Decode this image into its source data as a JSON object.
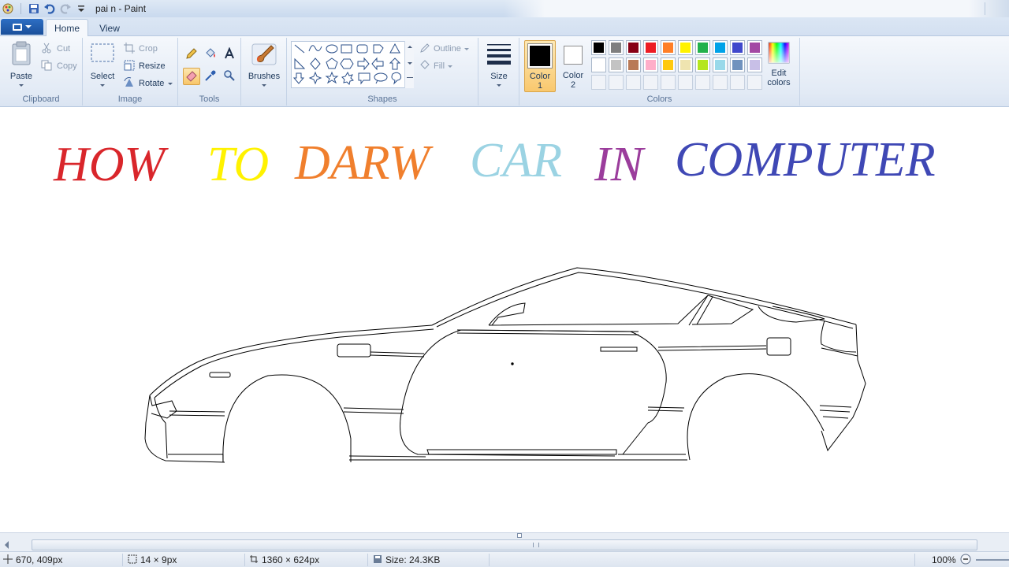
{
  "window": {
    "title": "pai n - Paint"
  },
  "tabs": {
    "home": "Home",
    "view": "View"
  },
  "ribbon": {
    "clipboard": {
      "label": "Clipboard",
      "paste": "Paste",
      "cut": "Cut",
      "copy": "Copy"
    },
    "image": {
      "label": "Image",
      "select": "Select",
      "crop": "Crop",
      "resize": "Resize",
      "rotate": "Rotate"
    },
    "tools": {
      "label": "Tools"
    },
    "brushes": {
      "label": "Brushes"
    },
    "shapes": {
      "label": "Shapes",
      "outline": "Outline",
      "fill": "Fill"
    },
    "size": {
      "label": "Size"
    },
    "colors": {
      "label": "Colors",
      "color1": "Color",
      "color1_num": "1",
      "color2": "Color",
      "color2_num": "2",
      "edit": "Edit",
      "edit2": "colors",
      "color1_value": "#000000",
      "color2_value": "#ffffff",
      "palette_row1": [
        "#000000",
        "#7f7f7f",
        "#880015",
        "#ed1c24",
        "#ff7f27",
        "#fff200",
        "#22b14c",
        "#00a2e8",
        "#3f48cc",
        "#a349a4"
      ],
      "palette_row2": [
        "#ffffff",
        "#c3c3c3",
        "#b97a57",
        "#ffaec9",
        "#ffc90e",
        "#efe4b0",
        "#b5e61d",
        "#99d9ea",
        "#7092be",
        "#c8bfe7"
      ],
      "palette_row3": [
        "#ffffff",
        "#ffffff",
        "#ffffff",
        "#ffffff",
        "#ffffff",
        "#ffffff",
        "#ffffff",
        "#ffffff",
        "#ffffff",
        "#ffffff"
      ]
    }
  },
  "canvas": {
    "headline": [
      {
        "text": "HOW",
        "color": "#d9262b"
      },
      {
        "text": "TO",
        "color": "#fff200"
      },
      {
        "text": "DARW",
        "color": "#f07f2d"
      },
      {
        "text": "CAR",
        "color": "#9bd3e3"
      },
      {
        "text": "IN",
        "color": "#9b3d9c"
      },
      {
        "text": "COMPUTER",
        "color": "#3f48b5"
      }
    ]
  },
  "status": {
    "cursor": "670, 409px",
    "selection": "14 × 9px",
    "canvas_size": "1360 × 624px",
    "file_size": "Size: 24.3KB",
    "zoom": "100%"
  }
}
